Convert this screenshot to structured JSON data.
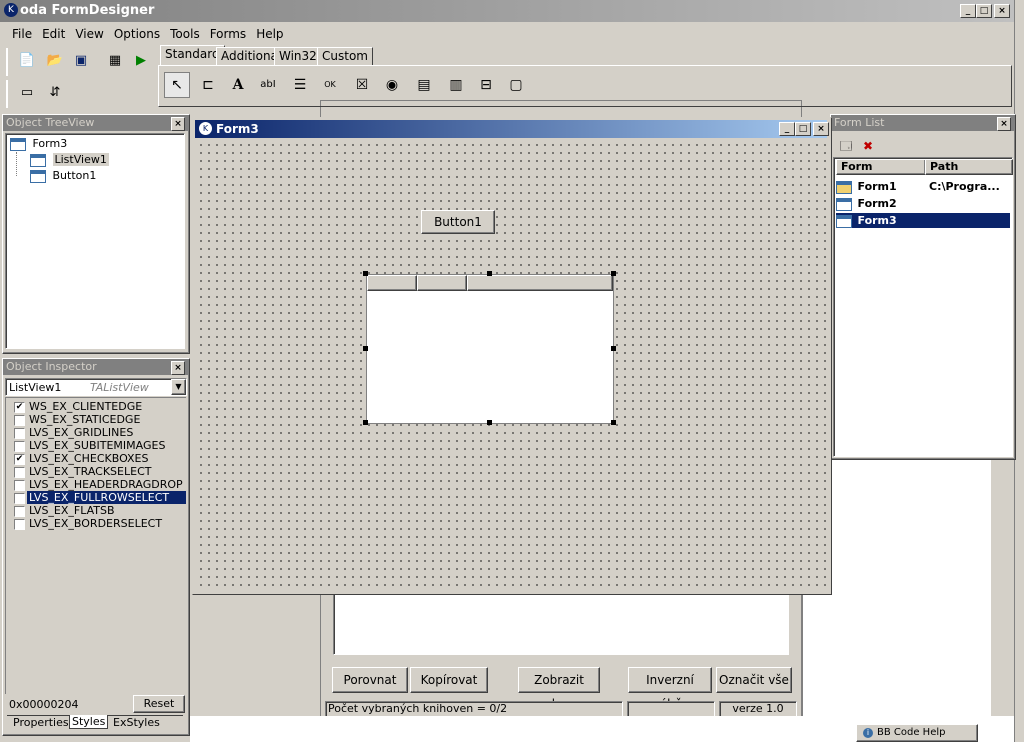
{
  "app": {
    "title": "oda FormDesigner"
  },
  "menu": [
    "File",
    "Edit",
    "View",
    "Options",
    "Tools",
    "Forms",
    "Help"
  ],
  "palette_tabs": [
    "Standard",
    "Additional",
    "Win32",
    "Custom"
  ],
  "tree": {
    "title": "Object TreeView",
    "root": "Form3",
    "children": [
      "ListView1",
      "Button1"
    ]
  },
  "inspector": {
    "title": "Object Inspector",
    "object": "ListView1",
    "type": "TAListView",
    "flags": [
      {
        "label": "WS_EX_CLIENTEDGE",
        "checked": true
      },
      {
        "label": "WS_EX_STATICEDGE",
        "checked": false
      },
      {
        "label": "LVS_EX_GRIDLINES",
        "checked": false
      },
      {
        "label": "LVS_EX_SUBITEMIMAGES",
        "checked": false
      },
      {
        "label": "LVS_EX_CHECKBOXES",
        "checked": true
      },
      {
        "label": "LVS_EX_TRACKSELECT",
        "checked": false
      },
      {
        "label": "LVS_EX_HEADERDRAGDROP",
        "checked": false
      },
      {
        "label": "LVS_EX_FULLROWSELECT",
        "checked": false,
        "selected": true
      },
      {
        "label": "LVS_EX_FLATSB",
        "checked": false
      },
      {
        "label": "LVS_EX_BORDERSELECT",
        "checked": false
      }
    ],
    "value": "0x00000204",
    "reset": "Reset",
    "tabs": [
      "Properties",
      "Styles",
      "ExStyles"
    ]
  },
  "form3": {
    "title": "Form3",
    "button": "Button1"
  },
  "formlist": {
    "title": "Form List",
    "columns": [
      "Form",
      "Path"
    ],
    "rows": [
      {
        "form": "Form1",
        "path": "C:\\Progra..."
      },
      {
        "form": "Form2",
        "path": ""
      },
      {
        "form": "Form3",
        "path": ""
      }
    ]
  },
  "background_app": {
    "buttons": [
      "Porovnat",
      "Kopírovat",
      "Zobrazit okna",
      "Inverzní výběr",
      "Označit vše"
    ],
    "status": "Počet vybraných knihoven = 0/2",
    "version": "verze 1.0"
  },
  "tray": {
    "bbcode": "BB Code Help"
  }
}
